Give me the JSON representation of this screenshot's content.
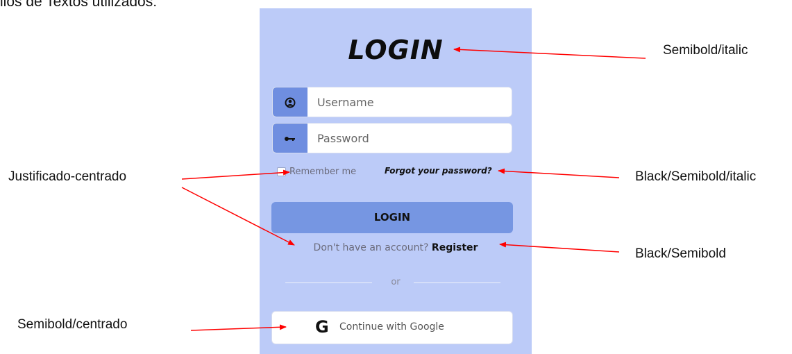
{
  "heading": {
    "text": "ilos de Textos utilizados:"
  },
  "form": {
    "title": "LOGIN",
    "username": {
      "placeholder": "Username",
      "icon": "user-circle-icon"
    },
    "password": {
      "placeholder": "Password",
      "icon": "key-icon"
    },
    "remember_label": "Remember me",
    "forgot_link": "Forgot your password?",
    "login_button": "LOGIN",
    "register_prompt": "Don't have an account?",
    "register_link": "Register",
    "divider_text": "or",
    "google_glyph": "G",
    "google_button": "Continue with Google"
  },
  "annotations": {
    "title_style": "Semibold/italic",
    "remember_style": "Justificado-centrado",
    "forgot_style": "Black/Semibold/italic",
    "register_style": "Black/Semibold",
    "google_style": "Semibold/centrado"
  },
  "colors": {
    "panel_background": "#bccbf8",
    "accent": "#7696e2",
    "arrow": "#ff0000"
  }
}
